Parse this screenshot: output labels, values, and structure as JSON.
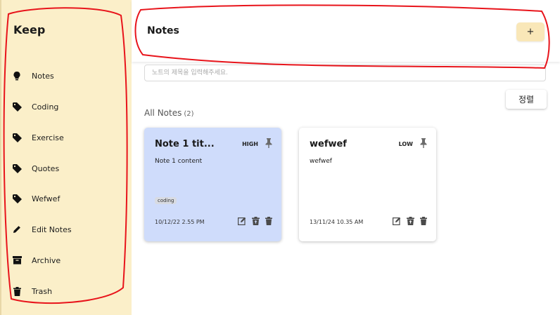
{
  "colors": {
    "sidebar_bg": "#fbefc9",
    "accent": "#f9e7b8",
    "card_high_bg": "#cfdcfb",
    "card_low_bg": "#ffffff"
  },
  "sidebar": {
    "brand": "Keep",
    "items": [
      {
        "label": "Notes",
        "icon": "lightbulb-icon"
      },
      {
        "label": "Coding",
        "icon": "tag-icon"
      },
      {
        "label": "Exercise",
        "icon": "tag-icon"
      },
      {
        "label": "Quotes",
        "icon": "tag-icon"
      },
      {
        "label": "Wefwef",
        "icon": "tag-icon"
      },
      {
        "label": "Edit Notes",
        "icon": "pencil-icon"
      },
      {
        "label": "Archive",
        "icon": "archive-icon"
      },
      {
        "label": "Trash",
        "icon": "trash-icon"
      }
    ]
  },
  "header": {
    "title": "Notes",
    "add_label": "+"
  },
  "search": {
    "placeholder": "노트의 제목을 입력해주세요."
  },
  "toolbar": {
    "sort_label": "정렬"
  },
  "section": {
    "title": "All Notes",
    "count": "(2)"
  },
  "notes": [
    {
      "title": "Note 1 tit...",
      "priority": "HIGH",
      "content": "Note 1 content",
      "tag": "coding",
      "date": "10/12/22 2.55 PM"
    },
    {
      "title": "wefwef",
      "priority": "LOW",
      "content": "wefwef",
      "tag": "",
      "date": "13/11/24 10.35 AM"
    }
  ]
}
